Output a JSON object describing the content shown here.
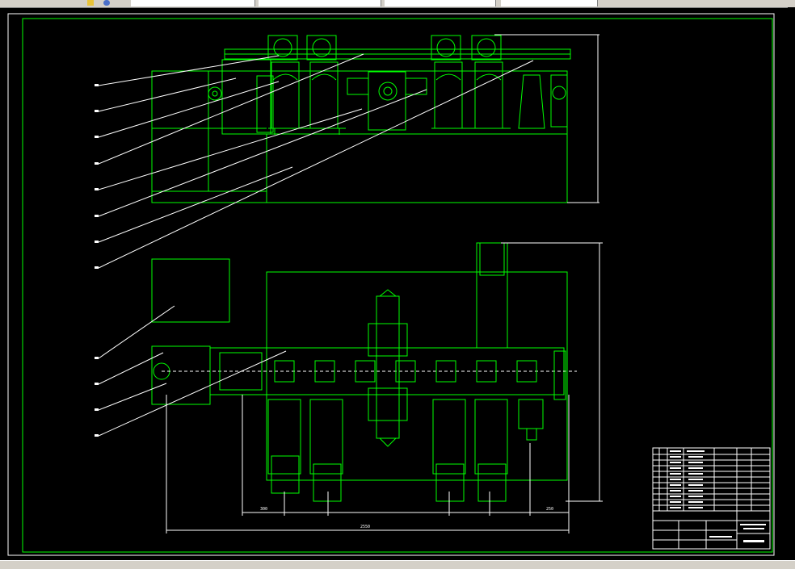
{
  "colors": {
    "background": "#000000",
    "frame": "#ffffff",
    "inner_frame": "#00ff00",
    "geometry": "#00ff00",
    "leader_lines": "#ffffff",
    "dimension_lines": "#ffffff",
    "toolbar": "#d4d0c8"
  },
  "toolbar": {
    "tabs": [
      "",
      "",
      "",
      "",
      ""
    ],
    "icons": [
      "layer-icon",
      "globe-icon"
    ]
  },
  "balloon_labels": [
    "",
    "",
    "",
    "",
    "",
    "",
    "",
    "",
    "",
    "",
    "",
    ""
  ],
  "dimensions": {
    "bottom_segments": [
      "300",
      "",
      "",
      "",
      "",
      "250"
    ],
    "overall_width": "2550",
    "top_view_height": "",
    "plan_view_height": ""
  },
  "title_block": {
    "parts_rows": 12,
    "drawing_title": "",
    "drawing_number": ""
  }
}
